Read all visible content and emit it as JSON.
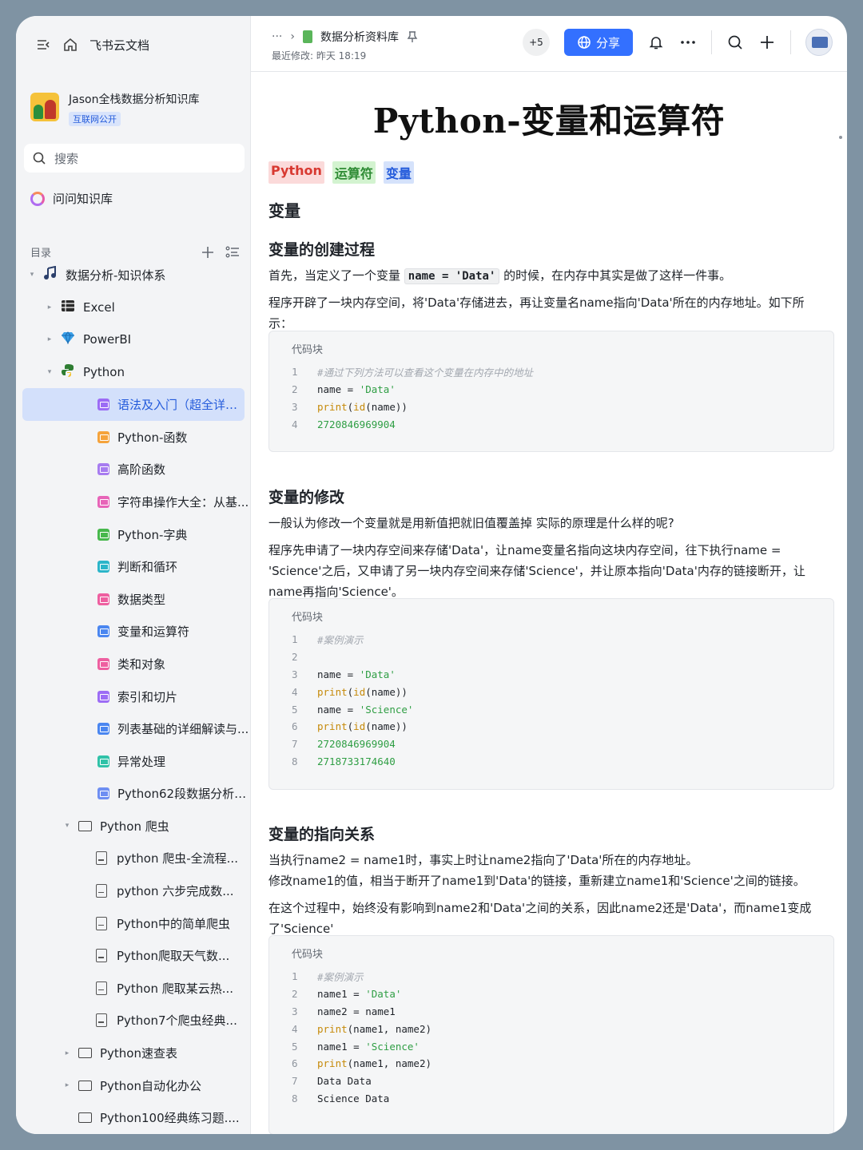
{
  "app": {
    "name": "飞书云文档",
    "kb_name": "Jason全栈数据分析知识库",
    "kb_badge": "互联网公开",
    "search_placeholder": "搜索",
    "ask_kb": "问问知识库",
    "toc_label": "目录"
  },
  "tree": [
    {
      "label": "数据分析-知识体系",
      "level": 0,
      "caret": "▾",
      "kind": "root"
    },
    {
      "label": "Excel",
      "level": 1,
      "caret": "▸",
      "kind": "excel"
    },
    {
      "label": "PowerBI",
      "level": 1,
      "caret": "▸",
      "kind": "powerbi"
    },
    {
      "label": "Python",
      "level": 1,
      "caret": "▾",
      "kind": "python"
    },
    {
      "label": "语法及入门（超全详解）",
      "level": 2,
      "kind": "doc",
      "color": "#9c6cf5",
      "active": true
    },
    {
      "label": "Python-函数",
      "level": 2,
      "kind": "doc",
      "color": "#f5a33b"
    },
    {
      "label": "高阶函数",
      "level": 2,
      "kind": "doc",
      "color": "#a77cf0"
    },
    {
      "label": "字符串操作大全：从基...",
      "level": 2,
      "kind": "doc",
      "color": "#e764b8"
    },
    {
      "label": "Python-字典",
      "level": 2,
      "kind": "doc",
      "color": "#47b84c"
    },
    {
      "label": "判断和循环",
      "level": 2,
      "kind": "doc",
      "color": "#2bb5c9"
    },
    {
      "label": "数据类型",
      "level": 2,
      "kind": "doc",
      "color": "#ee5fa0"
    },
    {
      "label": "变量和运算符",
      "level": 2,
      "kind": "doc",
      "color": "#4a86f0"
    },
    {
      "label": "类和对象",
      "level": 2,
      "kind": "doc",
      "color": "#ee5fa0"
    },
    {
      "label": "索引和切片",
      "level": 2,
      "kind": "doc",
      "color": "#9c6cf5"
    },
    {
      "label": "列表基础的详细解读与...",
      "level": 2,
      "kind": "doc",
      "color": "#4a86f0"
    },
    {
      "label": "异常处理",
      "level": 2,
      "kind": "doc",
      "color": "#30c2a8"
    },
    {
      "label": "Python62段数据分析和...",
      "level": 2,
      "kind": "doc",
      "color": "#6e8ef2"
    },
    {
      "label": "Python 爬虫",
      "level": 2,
      "caret": "▾",
      "kind": "folder"
    },
    {
      "label": "python 爬虫-全流程...",
      "level": 3,
      "kind": "file"
    },
    {
      "label": "python 六步完成数...",
      "level": 3,
      "kind": "file"
    },
    {
      "label": "Python中的简单爬虫",
      "level": 3,
      "kind": "file"
    },
    {
      "label": "Python爬取天气数...",
      "level": 3,
      "kind": "file"
    },
    {
      "label": "Python 爬取某云热...",
      "level": 3,
      "kind": "file"
    },
    {
      "label": "Python7个爬虫经典...",
      "level": 3,
      "kind": "file"
    },
    {
      "label": "Python速查表",
      "level": 2,
      "caret": "▸",
      "kind": "folder"
    },
    {
      "label": "Python自动化办公",
      "level": 2,
      "caret": "▸",
      "kind": "folder"
    },
    {
      "label": "Python100经典练习题....",
      "level": 2,
      "kind": "folder"
    }
  ],
  "header": {
    "breadcrumb_more": "···",
    "breadcrumb_sep": "›",
    "breadcrumb_title": "数据分析资料库",
    "modified": "最近修改: 昨天 18:19",
    "collab_count": "+5",
    "share_label": "分享"
  },
  "doc": {
    "title": "Python-变量和运算符",
    "tags": [
      {
        "label": "Python",
        "bg": "#fbdada",
        "fg": "#d83931"
      },
      {
        "label": "运算符",
        "bg": "#d3f3d0",
        "fg": "#2e8b34"
      },
      {
        "label": "变量",
        "bg": "#d5e2fb",
        "fg": "#245bdb"
      }
    ],
    "h_var": "变量",
    "h_create": "变量的创建过程",
    "p1_a": "首先，当定义了一个变量",
    "p1_code": "name = 'Data'",
    "p1_b": "的时候，在内存中其实是做了这样一件事。",
    "p2": "程序开辟了一块内存空间，将'Data'存储进去，再让变量名name指向'Data'所在的内存地址。如下所示：",
    "code_label": "代码块",
    "code1": [
      [
        {
          "t": "#通过下列方法可以查看这个变量在内存中的地址",
          "c": "cm"
        }
      ],
      [
        {
          "t": "name = ",
          "c": "tx"
        },
        {
          "t": "'Data'",
          "c": "st"
        }
      ],
      [
        {
          "t": "print",
          "c": "fn"
        },
        {
          "t": "(",
          "c": "tx"
        },
        {
          "t": "id",
          "c": "fn"
        },
        {
          "t": "(name))",
          "c": "tx"
        }
      ],
      [
        {
          "t": "2720846969904",
          "c": "st"
        }
      ]
    ],
    "h_modify": "变量的修改",
    "p3": "一般认为修改一个变量就是用新值把就旧值覆盖掉 实际的原理是什么样的呢?",
    "p4": "程序先申请了一块内存空间来存储'Data'，让name变量名指向这块内存空间，往下执行name = 'Science'之后，又申请了另一块内存空间来存储'Science'，并让原本指向'Data'内存的链接断开，让name再指向'Science'。",
    "code2": [
      [
        {
          "t": "#案例演示",
          "c": "cm"
        }
      ],
      [],
      [
        {
          "t": "name = ",
          "c": "tx"
        },
        {
          "t": "'Data'",
          "c": "st"
        }
      ],
      [
        {
          "t": "print",
          "c": "fn"
        },
        {
          "t": "(",
          "c": "tx"
        },
        {
          "t": "id",
          "c": "fn"
        },
        {
          "t": "(name))",
          "c": "tx"
        }
      ],
      [
        {
          "t": "name = ",
          "c": "tx"
        },
        {
          "t": "'Science'",
          "c": "st"
        }
      ],
      [
        {
          "t": "print",
          "c": "fn"
        },
        {
          "t": "(",
          "c": "tx"
        },
        {
          "t": "id",
          "c": "fn"
        },
        {
          "t": "(name))",
          "c": "tx"
        }
      ],
      [
        {
          "t": "2720846969904",
          "c": "st"
        }
      ],
      [
        {
          "t": "2718733174640",
          "c": "st"
        }
      ]
    ],
    "h_point": "变量的指向关系",
    "p5": "当执行name2 = name1时，事实上时让name2指向了'Data'所在的内存地址。",
    "p6": "修改name1的值，相当于断开了name1到'Data'的链接，重新建立name1和'Science'之间的链接。",
    "p7": "在这个过程中，始终没有影响到name2和'Data'之间的关系，因此name2还是'Data'，而name1变成了'Science'",
    "code3": [
      [
        {
          "t": "#案例演示",
          "c": "cm"
        }
      ],
      [
        {
          "t": "name1 = ",
          "c": "tx"
        },
        {
          "t": "'Data'",
          "c": "st"
        }
      ],
      [
        {
          "t": "name2 = name1",
          "c": "tx"
        }
      ],
      [
        {
          "t": "print",
          "c": "fn"
        },
        {
          "t": "(name1, name2)",
          "c": "tx"
        }
      ],
      [
        {
          "t": "name1 = ",
          "c": "tx"
        },
        {
          "t": "'Science'",
          "c": "st"
        }
      ],
      [
        {
          "t": "print",
          "c": "fn"
        },
        {
          "t": "(name1, name2)",
          "c": "tx"
        }
      ],
      [
        {
          "t": "Data Data",
          "c": "tx"
        }
      ],
      [
        {
          "t": "Science Data",
          "c": "tx"
        }
      ]
    ]
  }
}
